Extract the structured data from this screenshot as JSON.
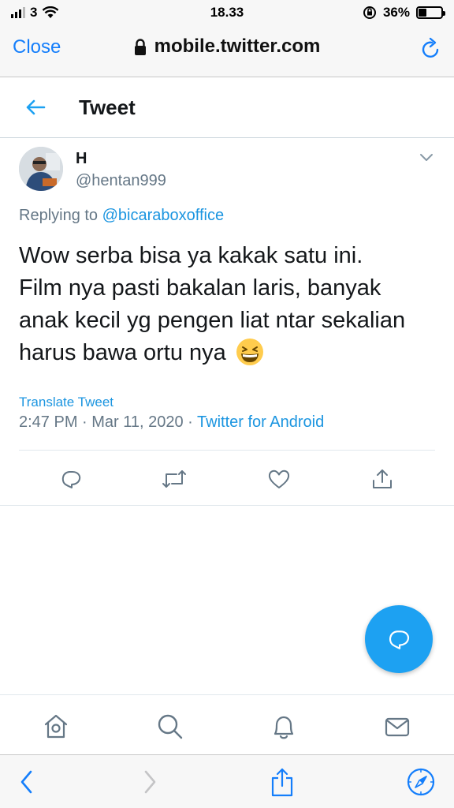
{
  "status_bar": {
    "carrier": "3",
    "time": "18.33",
    "battery_percent": "36%",
    "battery_level": 0.36
  },
  "browser": {
    "close_label": "Close",
    "url": "mobile.twitter.com"
  },
  "header": {
    "title": "Tweet"
  },
  "tweet": {
    "author_name": "H",
    "author_handle": "@hentan999",
    "replying_prefix": "Replying to",
    "replying_to": "@bicaraboxoffice",
    "text_lines": [
      "Wow serba bisa ya kakak satu ini.",
      "Film nya pasti bakalan laris, banyak",
      "anak kecil yg pengen liat ntar sekalian",
      "harus bawa ortu nya"
    ],
    "emoji": "grinning-squinting-face",
    "translate_label": "Translate Tweet",
    "timestamp": "2:47 PM · Mar 11, 2020 · ",
    "source": "Twitter for Android"
  },
  "actions": [
    "reply-icon",
    "retweet-icon",
    "like-icon",
    "share-icon"
  ],
  "bottom_nav": [
    "home-icon",
    "search-icon",
    "notifications-icon",
    "messages-icon"
  ],
  "colors": {
    "accent": "#1da1f2",
    "link": "#1b95e0",
    "secondary_text": "#657786",
    "safari_blue": "#147efb"
  }
}
